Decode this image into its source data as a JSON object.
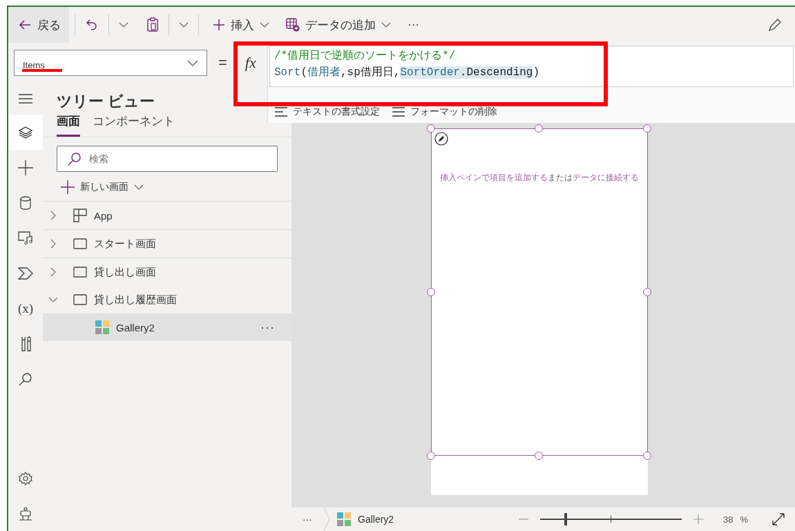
{
  "toolbar": {
    "back": "戻る",
    "insert": "挿入",
    "add_data": "データの追加",
    "more": "···"
  },
  "formula_bar": {
    "property": "Items",
    "equals": "=",
    "fx": "fx",
    "code_lines": [
      [
        {
          "kind": "comment",
          "text": "/*借用日で逆順のソートをかける*/"
        }
      ],
      [
        {
          "kind": "func",
          "text": "Sort"
        },
        {
          "kind": "plain",
          "text": "("
        },
        {
          "kind": "ident",
          "text": "借用者"
        },
        {
          "kind": "plain",
          "text": ",sp借用日,"
        },
        {
          "kind": "enum",
          "text": "SortOrder"
        },
        {
          "kind": "enum_plain",
          "text": ".Descending"
        },
        {
          "kind": "plain",
          "text": ")"
        }
      ]
    ],
    "format_buttons": [
      "テキストの書式設定",
      "フォーマットの削除"
    ]
  },
  "rail": [
    {
      "kind": "menu",
      "selected": false
    },
    {
      "kind": "layers",
      "selected": true
    },
    {
      "kind": "plus",
      "selected": false
    },
    {
      "kind": "data",
      "selected": false
    },
    {
      "kind": "media",
      "selected": false
    },
    {
      "kind": "flow",
      "selected": false
    },
    {
      "kind": "variables",
      "selected": false,
      "label": "(x)"
    },
    {
      "kind": "tools",
      "selected": false
    },
    {
      "kind": "search",
      "selected": false
    }
  ],
  "rail_bottom": [
    {
      "kind": "settings"
    },
    {
      "kind": "agent"
    }
  ],
  "tree": {
    "title": "ツリー ビュー",
    "tabs": [
      {
        "label": "画面",
        "selected": true
      },
      {
        "label": "コンポーネント",
        "selected": false
      }
    ],
    "search_placeholder": "検索",
    "new_screen": "新しい画面",
    "items": [
      {
        "kind": "app",
        "label": "App",
        "expanded": false,
        "selected": false
      },
      {
        "kind": "screen",
        "label": "スタート画面",
        "expanded": false,
        "selected": false
      },
      {
        "kind": "screen",
        "label": "貸し出し画面",
        "expanded": false,
        "selected": false
      },
      {
        "kind": "screen",
        "label": "貸し出し履歴画面",
        "expanded": true,
        "selected": false,
        "children": [
          {
            "kind": "gallery",
            "label": "Gallery2",
            "selected": true,
            "more": "···"
          }
        ]
      }
    ]
  },
  "gallery": {
    "parts": [
      {
        "kind": "link",
        "text": "挿入ペインで項目を追加する"
      },
      {
        "kind": "plain",
        "text": "または"
      },
      {
        "kind": "link",
        "text": "データに接続する"
      }
    ]
  },
  "status_bar": {
    "more": "···",
    "breadcrumb": "Gallery2",
    "zoom": {
      "level": 0.18,
      "value": "38",
      "unit": "%"
    }
  }
}
